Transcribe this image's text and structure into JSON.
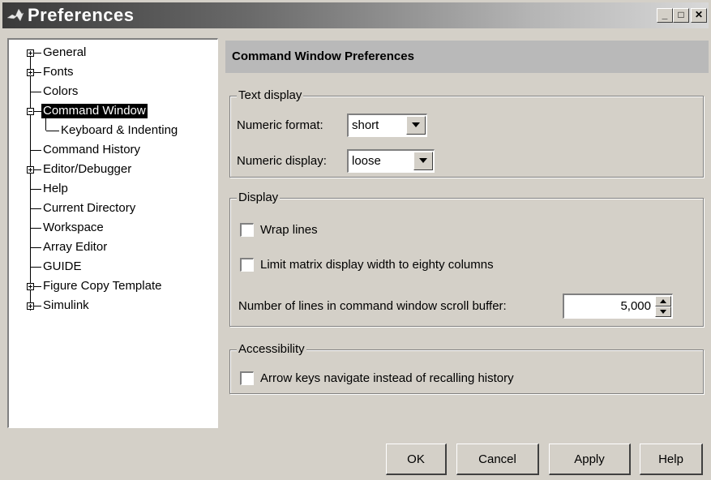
{
  "window": {
    "title": "Preferences",
    "minimize_glyph": "_",
    "maximize_glyph": "□",
    "close_glyph": "✕"
  },
  "tree": {
    "items": [
      {
        "label": "General",
        "expander": "+"
      },
      {
        "label": "Fonts",
        "expander": "+"
      },
      {
        "label": "Colors"
      },
      {
        "label": "Command Window",
        "expander": "-",
        "selected": true
      },
      {
        "label": "Keyboard & Indenting"
      },
      {
        "label": "Command History"
      },
      {
        "label": "Editor/Debugger",
        "expander": "+"
      },
      {
        "label": "Help"
      },
      {
        "label": "Current Directory"
      },
      {
        "label": "Workspace"
      },
      {
        "label": "Array Editor"
      },
      {
        "label": "GUIDE"
      },
      {
        "label": "Figure Copy Template",
        "expander": "+"
      },
      {
        "label": "Simulink",
        "expander": "+"
      }
    ]
  },
  "panel": {
    "title": "Command Window Preferences",
    "text_display": {
      "legend": "Text display",
      "numeric_format_label": "Numeric format:",
      "numeric_format_value": "short",
      "numeric_display_label": "Numeric display:",
      "numeric_display_value": "loose"
    },
    "display": {
      "legend": "Display",
      "wrap_lines_label": "Wrap lines",
      "wrap_lines_checked": false,
      "limit_matrix_label": "Limit matrix display width to eighty columns",
      "limit_matrix_checked": false,
      "scroll_buffer_label": "Number of lines in command window scroll buffer:",
      "scroll_buffer_value": "5,000"
    },
    "accessibility": {
      "legend": "Accessibility",
      "arrow_keys_label": "Arrow keys navigate instead of recalling history",
      "arrow_keys_checked": false
    }
  },
  "buttons": {
    "ok": "OK",
    "cancel": "Cancel",
    "apply": "Apply",
    "help": "Help"
  }
}
